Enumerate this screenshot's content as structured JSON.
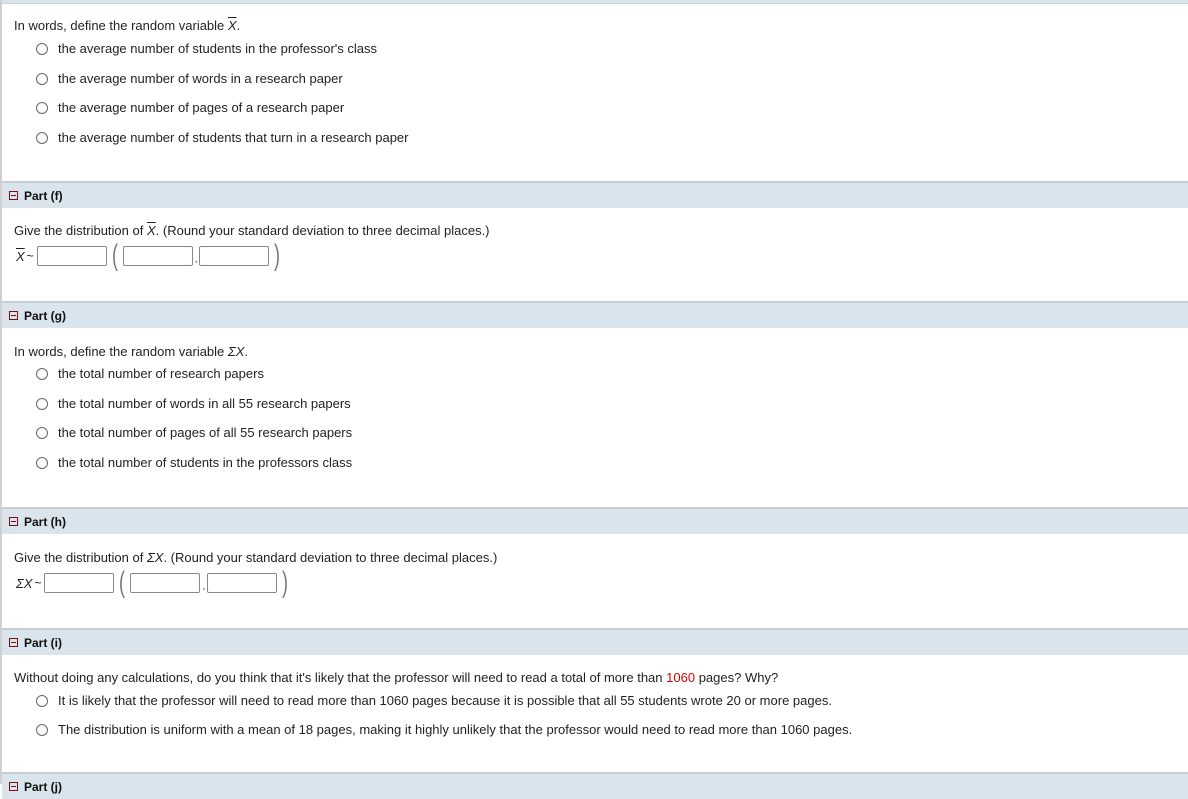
{
  "part_e": {
    "question_prefix": "In words, define the random variable",
    "question_symbol": "X",
    "question_suffix": ".",
    "options": [
      "the average number of students in the professor's class",
      "the average number of words in a research paper",
      "the average number of pages of a research paper",
      "the average number of students that turn in a research paper"
    ]
  },
  "part_f": {
    "header": "Part (f)",
    "question_prefix": "Give the distribution of",
    "question_symbol": "X",
    "question_suffix": ".  (Round your standard deviation to three decimal places.)",
    "dist_symbol": "X",
    "tilde": "~",
    "comma": ",",
    "fields": {
      "distribution": "",
      "mean": "",
      "std_dev": ""
    }
  },
  "part_g": {
    "header": "Part (g)",
    "question_prefix": "In words, define the random variable",
    "question_symbol": "ΣX",
    "question_suffix": ".",
    "options": [
      "the total number of research papers",
      "the total number of words in all 55 research papers",
      "the total number of pages of all 55 research papers",
      "the total number of students in the professors class"
    ]
  },
  "part_h": {
    "header": "Part (h)",
    "question_prefix": "Give the distribution of",
    "question_symbol": "ΣX",
    "question_suffix": ". (Round your standard deviation to three decimal places.)",
    "dist_symbol": "ΣX",
    "tilde": "~",
    "comma": ",",
    "fields": {
      "distribution": "",
      "mean": "",
      "std_dev": ""
    }
  },
  "part_i": {
    "header": "Part (i)",
    "question_prefix": "Without doing any calculations, do you think that it's likely that the professor will need to read a total of more than",
    "question_highlight": "1060",
    "question_suffix": "pages? Why?",
    "highlight_color": "#dd0000",
    "options": [
      "It is likely that the professor will need to read more than 1060 pages because it is possible that all 55 students wrote 20 or more pages.",
      "The distribution is uniform with a mean of 18 pages, making it highly unlikely that the professor would need to read more than 1060 pages."
    ]
  },
  "part_j": {
    "header": "Part (j)"
  }
}
